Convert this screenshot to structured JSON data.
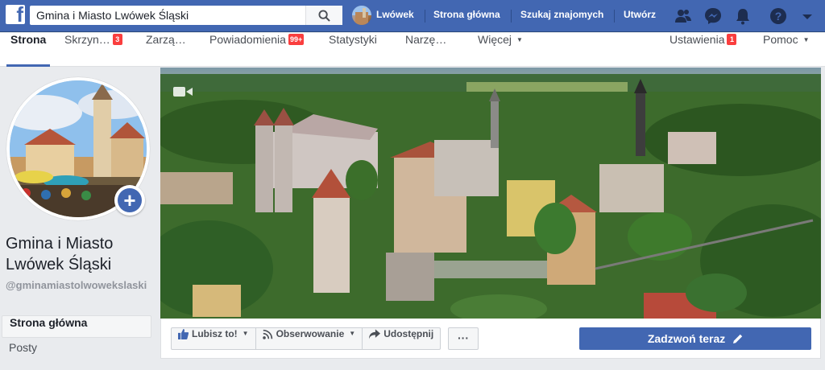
{
  "topbar": {
    "logo": "facebook-logo",
    "search_value": "Gmina i Miasto Lwówek Śląski",
    "profile_name": "Lwówek",
    "links": [
      "Strona główna",
      "Szukaj znajomych",
      "Utwórz"
    ],
    "icons": [
      "friends-icon",
      "messenger-icon",
      "bell-icon",
      "help-icon",
      "caret-down-icon"
    ],
    "bar_color": "#4267b2"
  },
  "pagenav": {
    "tabs": [
      {
        "label": "Strona"
      },
      {
        "label": "Skrzyn…",
        "badge": "3"
      },
      {
        "label": "Zarzą…"
      },
      {
        "label": "Powiadomienia",
        "badge": "99+"
      },
      {
        "label": "Statystyki"
      },
      {
        "label": "Narzę…"
      },
      {
        "label": "Więcej"
      }
    ],
    "right": [
      {
        "label": "Ustawienia",
        "badge": "1"
      },
      {
        "label": "Pomoc"
      }
    ]
  },
  "page": {
    "name": "Gmina i Miasto Lwówek Śląski",
    "handle": "@gminamiastolwowekslaski"
  },
  "left_menu": [
    "Strona główna",
    "Posty"
  ],
  "actions": {
    "like": "Lubisz to!",
    "follow": "Obserwowanie",
    "share": "Udostępnij",
    "more": "···",
    "call": "Zadzwoń teraz"
  }
}
